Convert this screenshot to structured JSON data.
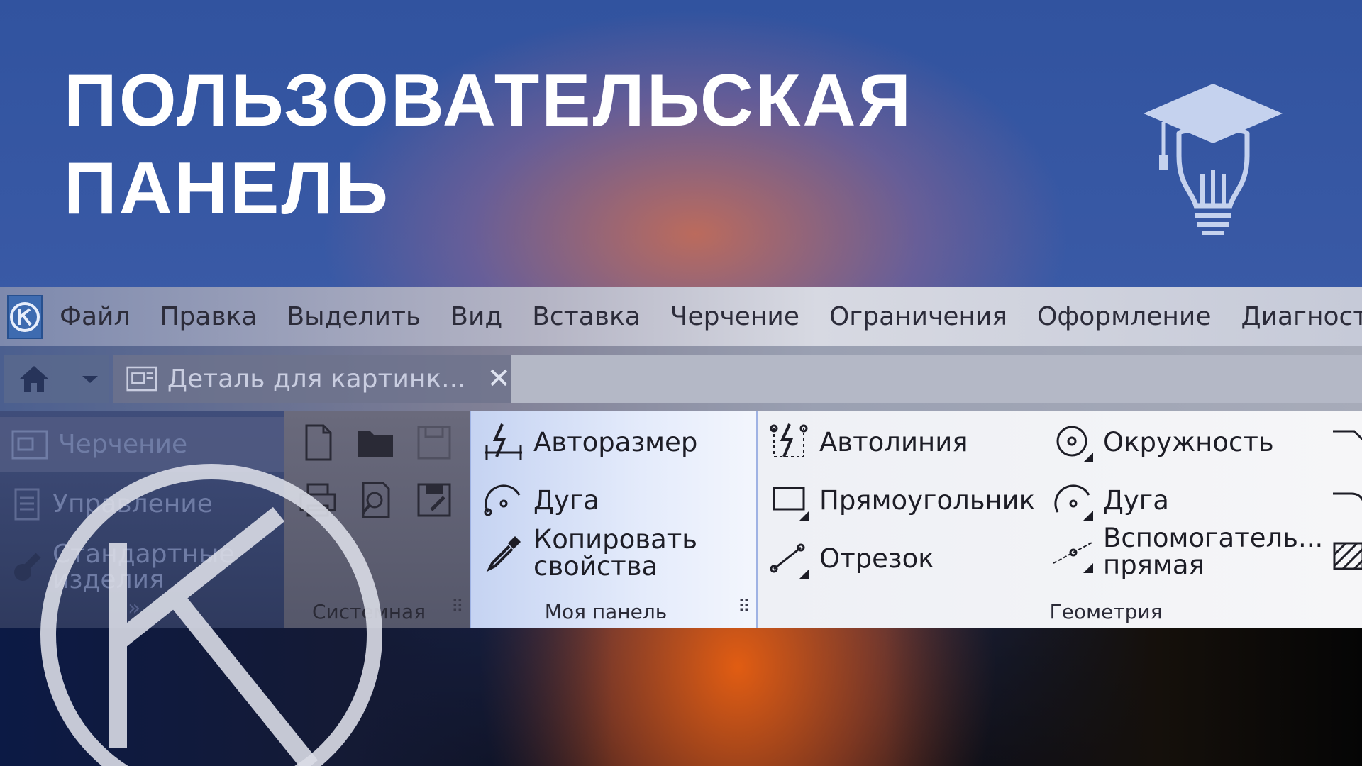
{
  "headline": {
    "line1": "ПОЛЬЗОВАТЕЛЬСКАЯ",
    "line2": "ПАНЕЛЬ"
  },
  "menu": [
    "Файл",
    "Правка",
    "Выделить",
    "Вид",
    "Вставка",
    "Черчение",
    "Ограничения",
    "Оформление",
    "Диагностик"
  ],
  "tabs": {
    "document": "Деталь для картинк...",
    "close": "✕"
  },
  "left_panel": {
    "items": [
      "Черчение",
      "Управление",
      "Стандартные изделия"
    ],
    "more": "»"
  },
  "groups": {
    "system": {
      "title": "Системная",
      "grip": "⠿"
    },
    "my_panel": {
      "title": "Моя панель",
      "grip": "⠿",
      "tools": [
        "Авторазмер",
        "Дуга",
        "Копировать свойства"
      ]
    },
    "geometry": {
      "title": "Геометрия",
      "tools": [
        "Автолиния",
        "Прямоугольник",
        "Отрезок",
        "Окружность",
        "Дуга",
        "Вспомогатель... прямая"
      ]
    }
  },
  "icons": {
    "cap": "graduation-cap-bulb-icon",
    "app": "kompas-app-icon",
    "brand": "kompas-k-logo"
  },
  "colors": {
    "accent_blue": "#3a5aa6",
    "accent_orange": "#e2601a",
    "highlight": "#c5d3f2"
  }
}
